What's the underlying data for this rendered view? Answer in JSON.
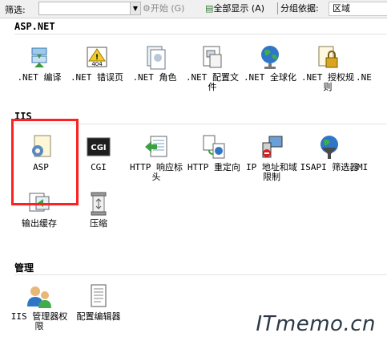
{
  "toolbar": {
    "filter_label": "筛选:",
    "start_label": "开始 (G)",
    "show_all_label": "全部显示 (A)",
    "group_by_label": "分组依据:",
    "group_by_value": "区域"
  },
  "sections": {
    "aspnet": {
      "title": "ASP.NET",
      "items": [
        {
          "label": ".NET 编译",
          "icon": "compile-icon"
        },
        {
          "label": ".NET 错误页",
          "icon": "error-page-icon"
        },
        {
          "label": ".NET 角色",
          "icon": "roles-icon"
        },
        {
          "label": ".NET 配置文件",
          "icon": "profile-icon"
        },
        {
          "label": ".NET 全球化",
          "icon": "globe-icon"
        },
        {
          "label": ".NET 授权规则",
          "icon": "authorization-icon"
        },
        {
          "label": ".NE",
          "icon": "more-icon"
        }
      ]
    },
    "iis": {
      "title": "IIS",
      "items": [
        {
          "label": "ASP",
          "icon": "asp-icon"
        },
        {
          "label": "CGI",
          "icon": "cgi-icon"
        },
        {
          "label": "HTTP 响应标头",
          "icon": "http-headers-icon"
        },
        {
          "label": "HTTP 重定向",
          "icon": "redirect-icon"
        },
        {
          "label": "IP 地址和域限制",
          "icon": "ip-restrict-icon"
        },
        {
          "label": "ISAPI 筛选器",
          "icon": "isapi-icon"
        },
        {
          "label": "MI",
          "icon": "mime-icon"
        },
        {
          "label": "输出缓存",
          "icon": "output-cache-icon"
        },
        {
          "label": "压缩",
          "icon": "compression-icon"
        }
      ]
    },
    "management": {
      "title": "管理",
      "items": [
        {
          "label": "IIS 管理器权限",
          "icon": "manager-permissions-icon"
        },
        {
          "label": "配置编辑器",
          "icon": "config-editor-icon"
        }
      ]
    }
  },
  "watermark": "ITmemo.cn",
  "colors": {
    "highlight": "#ff2020",
    "toolbar_bg": "#f0f0f0"
  }
}
